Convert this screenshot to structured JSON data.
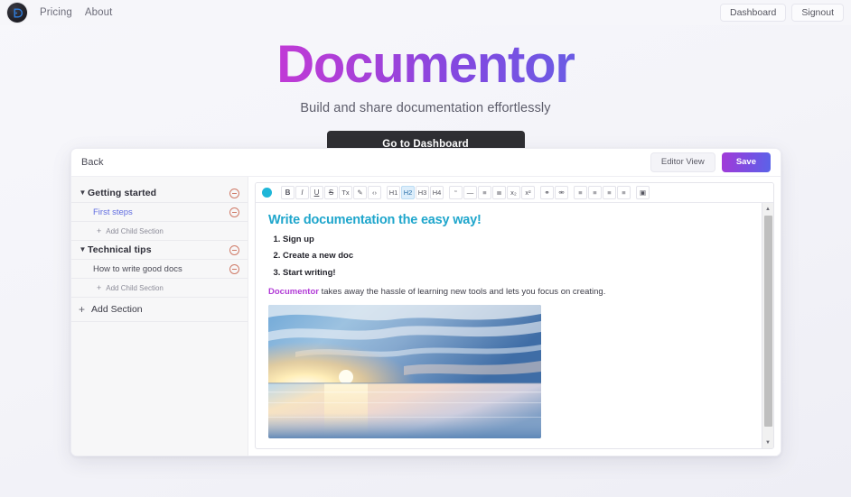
{
  "navbar": {
    "logo_alt": "Documentor logo",
    "links": [
      {
        "label": "Pricing"
      },
      {
        "label": "About"
      }
    ],
    "dashboard_label": "Dashboard",
    "signout_label": "Signout"
  },
  "hero": {
    "title": "Documentor",
    "subtitle": "Build and share documentation effortlessly",
    "cta_label": "Go to Dashboard",
    "title_gradient_from": "#c13ad6",
    "title_gradient_to": "#6b5ce4",
    "cta_bg": "#2f2f33"
  },
  "app": {
    "topbar": {
      "back_label": "Back",
      "editor_view_label": "Editor View",
      "save_label": "Save",
      "save_gradient_from": "#a23ad8",
      "save_gradient_to": "#5a63e8"
    },
    "sidebar": {
      "add_section_label": "Add Section",
      "add_child_label": "Add Child Section",
      "active_color": "#5f6ce0",
      "remove_color": "#cf7a67",
      "sections": [
        {
          "label": "Getting started",
          "expanded": true,
          "pages": [
            {
              "label": "First steps",
              "active": true
            }
          ]
        },
        {
          "label": "Technical tips",
          "expanded": true,
          "pages": [
            {
              "label": "How to write good docs",
              "active": false
            }
          ]
        }
      ]
    },
    "toolbar": {
      "swatch_color": "#1fb6d8",
      "groups": [
        {
          "buttons": [
            {
              "name": "bold",
              "glyph": "B",
              "style": "bold",
              "active": false
            },
            {
              "name": "italic",
              "glyph": "I",
              "style": "italic",
              "active": false
            },
            {
              "name": "underline",
              "glyph": "U",
              "style": "underline",
              "active": false
            },
            {
              "name": "strikethrough",
              "glyph": "S",
              "style": "strike",
              "active": false
            },
            {
              "name": "clear-format",
              "glyph": "Tx",
              "style": "plain",
              "active": false
            },
            {
              "name": "highlight",
              "glyph": "✎",
              "style": "plain",
              "active": false
            },
            {
              "name": "code",
              "glyph": "‹›",
              "style": "plain",
              "active": false
            }
          ]
        },
        {
          "buttons": [
            {
              "name": "heading-1",
              "glyph": "H1",
              "style": "plain",
              "active": false
            },
            {
              "name": "heading-2",
              "glyph": "H2",
              "style": "plain",
              "active": true
            },
            {
              "name": "heading-3",
              "glyph": "H3",
              "style": "plain",
              "active": false
            },
            {
              "name": "heading-4",
              "glyph": "H4",
              "style": "plain",
              "active": false
            }
          ]
        },
        {
          "buttons": [
            {
              "name": "blockquote",
              "glyph": "“",
              "style": "plain",
              "active": false
            },
            {
              "name": "horizontal-rule",
              "glyph": "—",
              "style": "plain",
              "active": false
            },
            {
              "name": "bullet-list",
              "glyph": "≡",
              "style": "plain",
              "active": false
            },
            {
              "name": "numbered-list",
              "glyph": "≣",
              "style": "plain",
              "active": false
            },
            {
              "name": "subscript",
              "glyph": "x₂",
              "style": "plain",
              "active": false
            },
            {
              "name": "superscript",
              "glyph": "x²",
              "style": "plain",
              "active": false
            }
          ]
        },
        {
          "buttons": [
            {
              "name": "insert-link",
              "glyph": "⚭",
              "style": "plain",
              "active": false
            },
            {
              "name": "unlink",
              "glyph": "⚮",
              "style": "plain",
              "active": false
            }
          ]
        },
        {
          "buttons": [
            {
              "name": "align-left",
              "glyph": "≡",
              "style": "plain",
              "active": false
            },
            {
              "name": "align-center",
              "glyph": "≡",
              "style": "plain",
              "active": false
            },
            {
              "name": "align-right",
              "glyph": "≡",
              "style": "plain",
              "active": false
            },
            {
              "name": "align-justify",
              "glyph": "≡",
              "style": "plain",
              "active": false
            }
          ]
        },
        {
          "buttons": [
            {
              "name": "insert-image",
              "glyph": "▣",
              "style": "plain",
              "active": false
            }
          ]
        }
      ]
    },
    "document": {
      "heading": "Write documentation the easy way!",
      "heading_color": "#1fa6cc",
      "steps": [
        "Sign up",
        "Create a new doc",
        "Start writing!"
      ],
      "paragraph_brand": "Documentor",
      "paragraph_rest": " takes away the hassle of learning new tools and lets you focus on creating.",
      "brand_color": "#b13bd6",
      "image_alt": "Sunset over calm ocean water with clouds"
    },
    "scrollbar": {
      "up_glyph": "▲",
      "down_glyph": "▼"
    }
  }
}
